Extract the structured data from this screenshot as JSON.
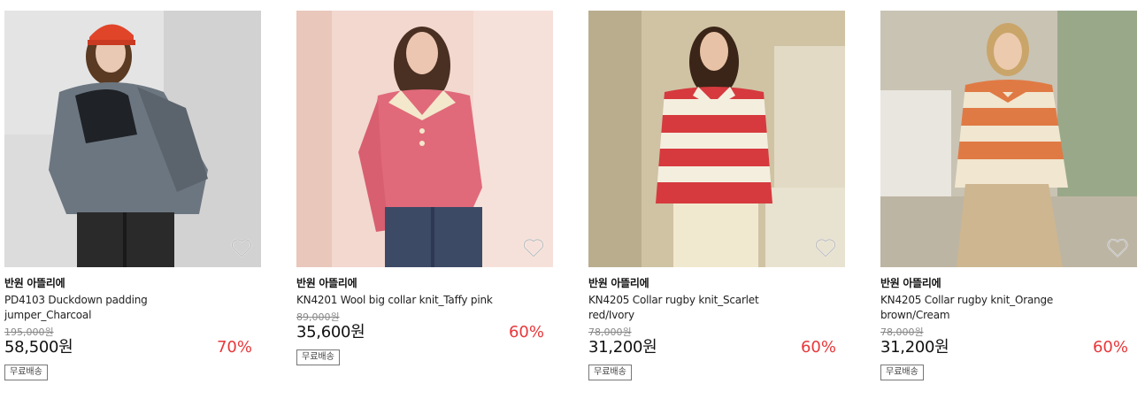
{
  "products": [
    {
      "brand": "반원 아뜰리에",
      "name": "PD4103 Duckdown padding jumper_Charcoal",
      "original_price": "195,000원",
      "sale_price": "58,500원",
      "discount": "70%",
      "shipping": "무료배송",
      "wishlist_icon": "heart-outline-icon"
    },
    {
      "brand": "반원 아뜰리에",
      "name": "KN4201 Wool big collar knit_Taffy pink",
      "original_price": "89,000원",
      "sale_price": "35,600원",
      "discount": "60%",
      "shipping": "무료배송",
      "wishlist_icon": "heart-outline-icon"
    },
    {
      "brand": "반원 아뜰리에",
      "name": "KN4205 Collar rugby knit_Scarlet red/Ivory",
      "original_price": "78,000원",
      "sale_price": "31,200원",
      "discount": "60%",
      "shipping": "무료배송",
      "wishlist_icon": "heart-outline-icon"
    },
    {
      "brand": "반원 아뜰리에",
      "name": "KN4205 Collar rugby knit_Orange brown/Cream",
      "original_price": "78,000원",
      "sale_price": "31,200원",
      "discount": "60%",
      "shipping": "무료배송",
      "wishlist_icon": "heart-outline-icon"
    }
  ],
  "colors": {
    "discount": "#e8373a",
    "strike_price": "#888888",
    "badge_border": "#777777"
  }
}
